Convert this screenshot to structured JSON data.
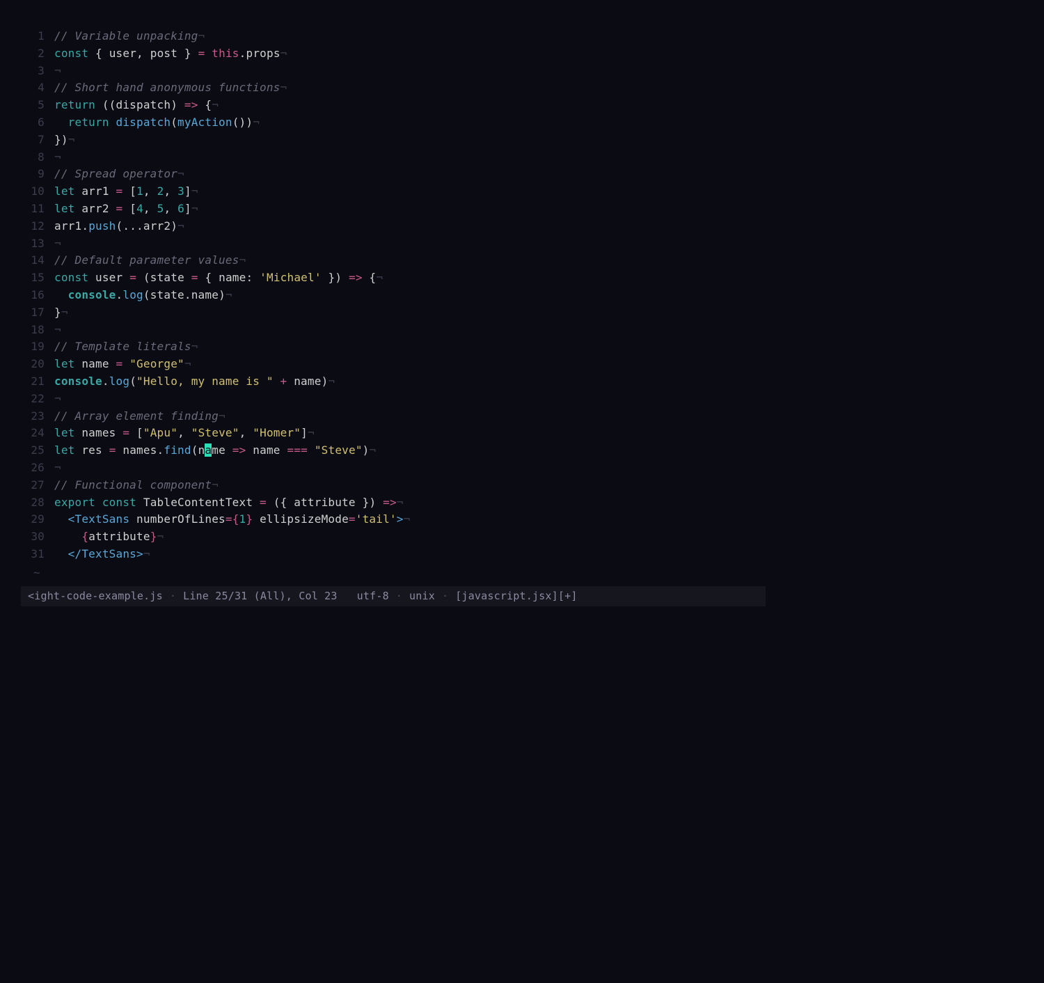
{
  "lines": {
    "l1": {
      "n": "1",
      "comment": "// Variable unpacking"
    },
    "l2": {
      "n": "2",
      "const": "const",
      "brace_o": "{",
      "user": "user",
      "comma": ",",
      "post": "post",
      "brace_c": "}",
      "eq": "=",
      "this": "this",
      "dot": ".",
      "props": "props"
    },
    "l3": {
      "n": "3"
    },
    "l4": {
      "n": "4",
      "comment": "// Short hand anonymous functions"
    },
    "l5": {
      "n": "5",
      "return": "return",
      "po": "((",
      "dispatch": "dispatch",
      "pc": ")",
      "arrow": "=>",
      "brace_o": "{"
    },
    "l6": {
      "n": "6",
      "return": "return",
      "dispatch": "dispatch",
      "po": "(",
      "myAction": "myAction",
      "po2": "(",
      "pc2": ")",
      "pc": ")"
    },
    "l7": {
      "n": "7",
      "brace_c": "}",
      "pc": ")"
    },
    "l8": {
      "n": "8"
    },
    "l9": {
      "n": "9",
      "comment": "// Spread operator"
    },
    "l10": {
      "n": "10",
      "let": "let",
      "arr1": "arr1",
      "eq": "=",
      "bo": "[",
      "v1": "1",
      "c1": ",",
      "v2": "2",
      "c2": ",",
      "v3": "3",
      "bc": "]"
    },
    "l11": {
      "n": "11",
      "let": "let",
      "arr2": "arr2",
      "eq": "=",
      "bo": "[",
      "v1": "4",
      "c1": ",",
      "v2": "5",
      "c2": ",",
      "v3": "6",
      "bc": "]"
    },
    "l12": {
      "n": "12",
      "arr1": "arr1",
      "dot": ".",
      "push": "push",
      "po": "(",
      "spread": "...",
      "arr2": "arr2",
      "pc": ")"
    },
    "l13": {
      "n": "13"
    },
    "l14": {
      "n": "14",
      "comment": "// Default parameter values"
    },
    "l15": {
      "n": "15",
      "const": "const",
      "user": "user",
      "eq": "=",
      "po": "(",
      "state": "state",
      "eq2": "=",
      "bo": "{",
      "namek": "name",
      "colon": ":",
      "str": "'Michael'",
      "bc": "}",
      "pc": ")",
      "arrow": "=>",
      "bo2": "{"
    },
    "l16": {
      "n": "16",
      "console": "console",
      "dot": ".",
      "log": "log",
      "po": "(",
      "state": "state",
      "dot2": ".",
      "name": "name",
      "pc": ")"
    },
    "l17": {
      "n": "17",
      "bc": "}"
    },
    "l18": {
      "n": "18"
    },
    "l19": {
      "n": "19",
      "comment": "// Template literals"
    },
    "l20": {
      "n": "20",
      "let": "let",
      "name": "name",
      "eq": "=",
      "str": "\"George\""
    },
    "l21": {
      "n": "21",
      "console": "console",
      "dot": ".",
      "log": "log",
      "po": "(",
      "str": "\"Hello, my name is \"",
      "plus": "+",
      "name": "name",
      "pc": ")"
    },
    "l22": {
      "n": "22"
    },
    "l23": {
      "n": "23",
      "comment": "// Array element finding"
    },
    "l24": {
      "n": "24",
      "let": "let",
      "names": "names",
      "eq": "=",
      "bo": "[",
      "s1": "\"Apu\"",
      "c1": ",",
      "s2": "\"Steve\"",
      "c2": ",",
      "s3": "\"Homer\"",
      "bc": "]"
    },
    "l25": {
      "n": "25",
      "let": "let",
      "res": "res",
      "eq": "=",
      "names": "names",
      "dot": ".",
      "find": "find",
      "po": "(",
      "n_pre": "n",
      "n_cur": "a",
      "n_post": "me",
      "arrow": "=>",
      "name2": "name",
      "eqeq": "===",
      "str": "\"Steve\"",
      "pc": ")"
    },
    "l26": {
      "n": "26"
    },
    "l27": {
      "n": "27",
      "comment": "// Functional component"
    },
    "l28": {
      "n": "28",
      "export": "export",
      "const": "const",
      "TCT": "TableContentText",
      "eq": "=",
      "po": "(",
      "bo": "{",
      "attr": "attribute",
      "bc": "}",
      "pc": ")",
      "arrow": "=>"
    },
    "l29": {
      "n": "29",
      "lt": "<",
      "tag": "TextSans",
      "a1": "numberOfLines",
      "eq1": "=",
      "jb_o": "{",
      "one": "1",
      "jb_c": "}",
      "a2": "ellipsizeMode",
      "eq2": "=",
      "str": "'tail'",
      "gt": ">"
    },
    "l30": {
      "n": "30",
      "jb_o": "{",
      "attr": "attribute",
      "jb_c": "}"
    },
    "l31": {
      "n": "31",
      "lt": "</",
      "tag": "TextSans",
      "gt": ">"
    }
  },
  "nl": "¬",
  "tilde": "~",
  "status": {
    "file": "<ight-code-example.js",
    "pos": "Line 25/31 (All), Col 23",
    "enc": "utf-8",
    "ff": "unix",
    "ft": "[javascript.jsx][+]",
    "sep": "·"
  }
}
